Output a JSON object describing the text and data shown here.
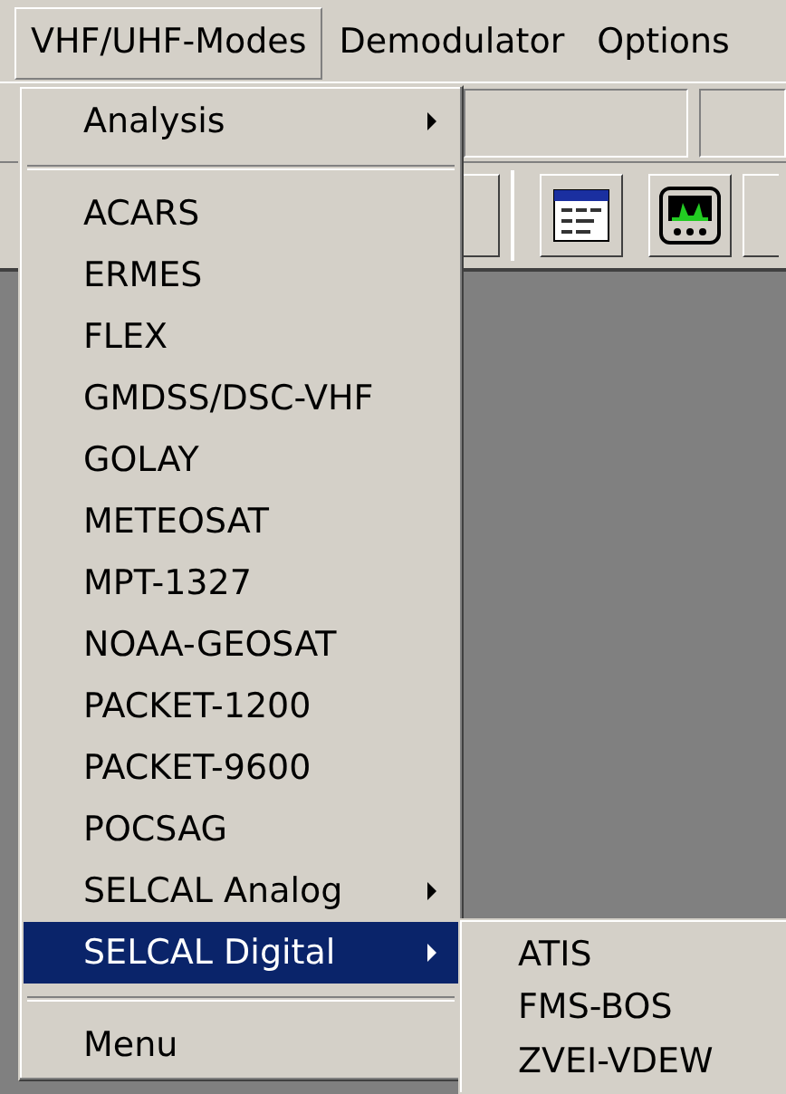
{
  "menu_bar": [
    {
      "label": "VHF/UHF-Modes",
      "selected": true
    },
    {
      "label": "Demodulator",
      "selected": false
    },
    {
      "label": "Options",
      "selected": false
    }
  ],
  "menu": {
    "items": [
      {
        "kind": "item",
        "label": "Analysis",
        "submenu": true,
        "selected": false
      },
      {
        "kind": "separator"
      },
      {
        "kind": "item",
        "label": "ACARS",
        "submenu": false,
        "selected": false
      },
      {
        "kind": "item",
        "label": "ERMES",
        "submenu": false,
        "selected": false
      },
      {
        "kind": "item",
        "label": "FLEX",
        "submenu": false,
        "selected": false
      },
      {
        "kind": "item",
        "label": "GMDSS/DSC-VHF",
        "submenu": false,
        "selected": false
      },
      {
        "kind": "item",
        "label": "GOLAY",
        "submenu": false,
        "selected": false
      },
      {
        "kind": "item",
        "label": "METEOSAT",
        "submenu": false,
        "selected": false
      },
      {
        "kind": "item",
        "label": "MPT-1327",
        "submenu": false,
        "selected": false
      },
      {
        "kind": "item",
        "label": "NOAA-GEOSAT",
        "submenu": false,
        "selected": false
      },
      {
        "kind": "item",
        "label": "PACKET-1200",
        "submenu": false,
        "selected": false
      },
      {
        "kind": "item",
        "label": "PACKET-9600",
        "submenu": false,
        "selected": false
      },
      {
        "kind": "item",
        "label": "POCSAG",
        "submenu": false,
        "selected": false
      },
      {
        "kind": "item",
        "label": "SELCAL Analog",
        "submenu": true,
        "selected": false
      },
      {
        "kind": "item",
        "label": "SELCAL Digital",
        "submenu": true,
        "selected": true
      },
      {
        "kind": "separator"
      },
      {
        "kind": "item",
        "label": "Menu",
        "submenu": false,
        "selected": false
      }
    ]
  },
  "submenu": {
    "items": [
      {
        "label": "ATIS"
      },
      {
        "label": "FMS-BOS"
      },
      {
        "label": "ZVEI-VDEW"
      }
    ]
  }
}
